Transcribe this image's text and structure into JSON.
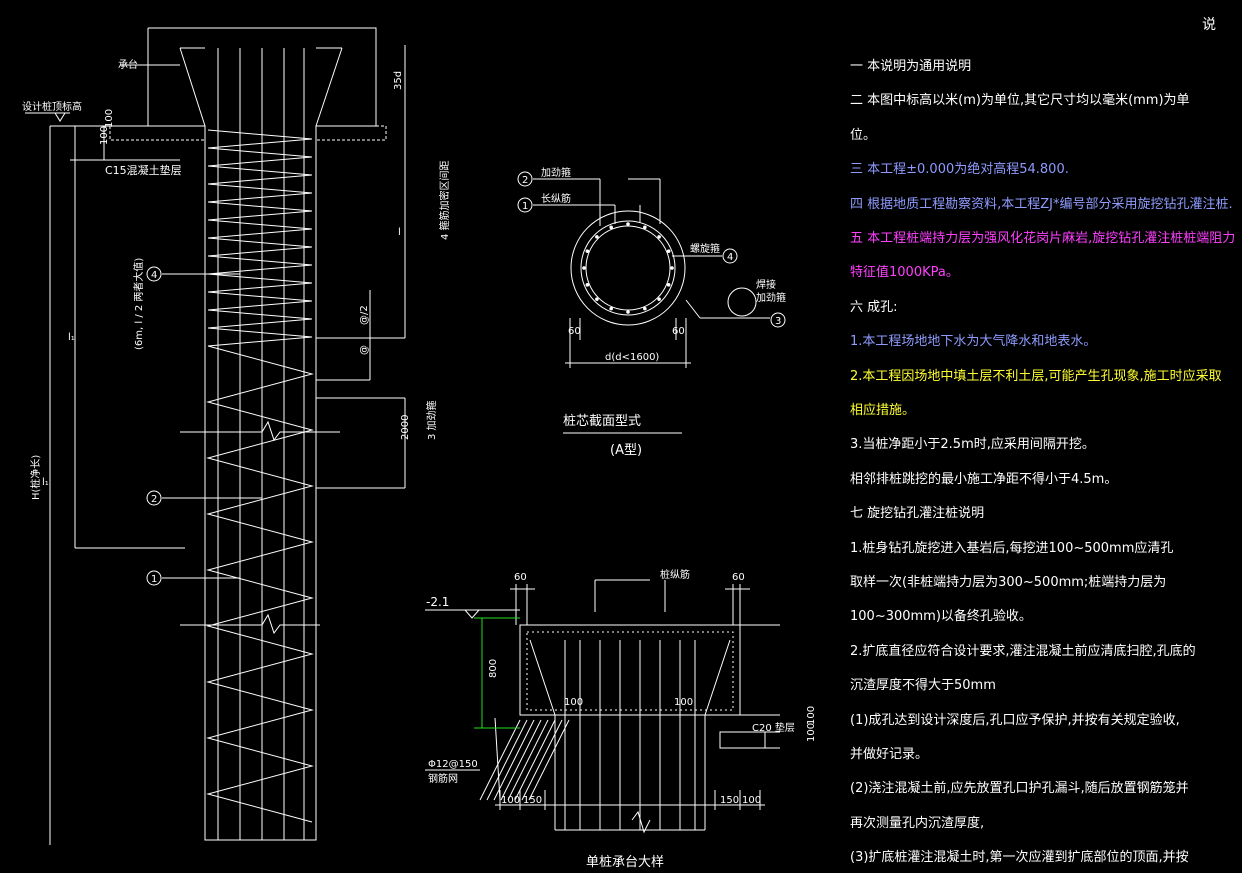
{
  "corner_char": "说",
  "pile": {
    "cap": "承台",
    "design_top": "设计桩顶标高",
    "cushion": "C15混凝土垫层",
    "dim_35d": "35d",
    "dim_100a": "100",
    "dim_100b": "100",
    "rebar_len": "4 箍筋加密区间距",
    "l_label": "l",
    "at2": "@/2",
    "at": "@",
    "dim_2000": "2000",
    "stiff": "3 加劲箍",
    "l1_label": "l₁",
    "l1_note": "(6m, l / 2 两者大值)",
    "pile_len": "H(桩净长)",
    "ll_label": "l₁",
    "marks": [
      "4",
      "2",
      "1"
    ]
  },
  "section": {
    "m2": "2",
    "m2_label": "加劲箍",
    "m1": "1",
    "m1_label": "长纵筋",
    "m4": "4",
    "m4_label": "螺旋箍",
    "m3": "3",
    "weld": "焊接",
    "stiff_hoop": "加劲箍",
    "d60a": "60",
    "d60b": "60",
    "diam": "d(d<1600)",
    "title": "桩芯截面型式",
    "subtitle": "(A型)"
  },
  "cap_detail": {
    "d60a": "60",
    "d60b": "60",
    "rebar": "桩纵筋",
    "elev": "-2.1",
    "d800": "800",
    "d100a": "100",
    "d100b": "100",
    "c20": "C20 垫层",
    "d100c": "100",
    "d100d": "100",
    "mesh": "Φ12@150",
    "mesh2": "钢筋网",
    "b100": "100",
    "b150": "150",
    "b150b": "150",
    "b100b": "100",
    "title": "单桩承台大样"
  },
  "notes": [
    {
      "text": "一  本说明为通用说明",
      "cls": "w"
    },
    {
      "text": "二  本图中标高以米(m)为单位,其它尺寸均以毫米(mm)为单",
      "cls": "w"
    },
    {
      "text": "     位。",
      "cls": "w"
    },
    {
      "text": "三  本工程±0.000为绝对高程54.800.",
      "cls": "b"
    },
    {
      "text": "四  根据地质工程勘察资料,本工程ZJ*编号部分采用旋挖钻孔灌注桩.",
      "cls": "b"
    },
    {
      "text": "五  本工程桩端持力层为强风化花岗片麻岩,旋挖钻孔灌注桩桩端阻力",
      "cls": "m"
    },
    {
      "text": "    特征值1000KPa。",
      "cls": "m"
    },
    {
      "text": "六  成孔:",
      "cls": "w"
    },
    {
      "text": "1.本工程场地地下水为大气降水和地表水。",
      "cls": "b"
    },
    {
      "text": "2.本工程因场地中填土层不利土层,可能产生孔现象,施工时应采取",
      "cls": "y"
    },
    {
      "text": "   相应措施。",
      "cls": "y"
    },
    {
      "text": "3.当桩净距小于2.5m时,应采用间隔开挖。",
      "cls": "w"
    },
    {
      "text": "   相邻排桩跳挖的最小施工净距不得小于4.5m。",
      "cls": "w"
    },
    {
      "text": "七  旋挖钻孔灌注桩说明",
      "cls": "w"
    },
    {
      "text": " 1.桩身钻孔旋挖进入基岩后,每挖进100~500mm应清孔",
      "cls": "w"
    },
    {
      "text": "     取样一次(非桩端持力层为300~500mm;桩端持力层为",
      "cls": "w"
    },
    {
      "text": "     100~300mm)以备终孔验收。",
      "cls": "w"
    },
    {
      "text": " 2.扩底直径应符合设计要求,灌注混凝土前应清底扫腔,孔底的",
      "cls": "w"
    },
    {
      "text": "     沉渣厚度不得大于50mm",
      "cls": "w"
    },
    {
      "text": " (1)成孔达到设计深度后,孔口应予保护,并按有关规定验收,",
      "cls": "w"
    },
    {
      "text": "       并做好记录。",
      "cls": "w"
    },
    {
      "text": " (2)浇注混凝土前,应先放置孔口护孔漏斗,随后放置钢筋笼并",
      "cls": "w"
    },
    {
      "text": "       再次测量孔内沉渣厚度,",
      "cls": "w"
    },
    {
      "text": " (3)扩底桩灌注混凝土时,第一次应灌到扩底部位的顶面,并按",
      "cls": "w"
    }
  ]
}
